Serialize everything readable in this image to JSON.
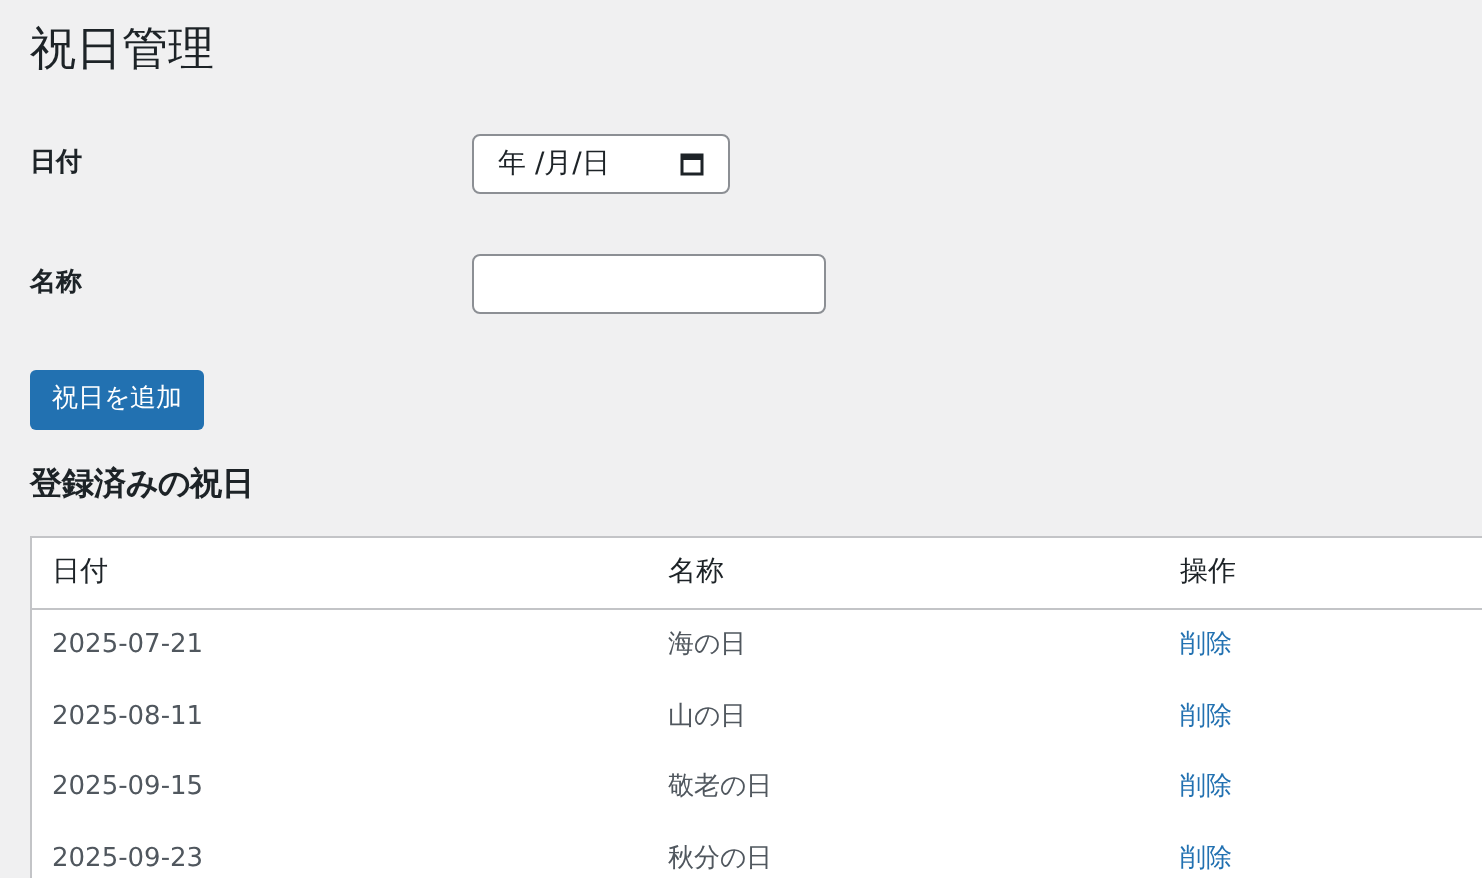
{
  "title": "祝日管理",
  "form": {
    "date_label": "日付",
    "date_placeholder": "年 /月/日",
    "name_label": "名称",
    "submit": "祝日を追加"
  },
  "section_title": "登録済みの祝日",
  "table": {
    "columns": [
      "日付",
      "名称",
      "操作"
    ],
    "rows": [
      {
        "date": "2025-07-21",
        "name": "海の日",
        "action": "削除"
      },
      {
        "date": "2025-08-11",
        "name": "山の日",
        "action": "削除"
      },
      {
        "date": "2025-09-15",
        "name": "敬老の日",
        "action": "削除"
      },
      {
        "date": "2025-09-23",
        "name": "秋分の日",
        "action": "削除"
      }
    ]
  }
}
